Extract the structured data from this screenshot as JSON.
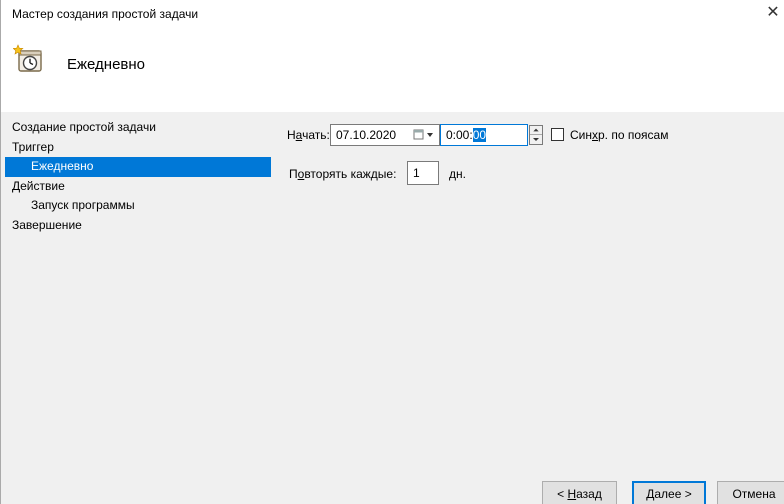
{
  "window": {
    "title": "Мастер создания простой задачи",
    "close_glyph": "✕"
  },
  "header": {
    "heading": "Ежедневно",
    "icon": "task-clock-icon"
  },
  "steps": [
    {
      "label": "Создание простой задачи",
      "level": 0,
      "active": false
    },
    {
      "label": "Триггер",
      "level": 0,
      "active": false
    },
    {
      "label": "Ежедневно",
      "level": 1,
      "active": true
    },
    {
      "label": "Действие",
      "level": 0,
      "active": false
    },
    {
      "label": "Запуск программы",
      "level": 1,
      "active": false
    },
    {
      "label": "Завершение",
      "level": 0,
      "active": false
    }
  ],
  "form": {
    "start_label_pre": "Н",
    "start_label_ul": "а",
    "start_label_post": "чать:",
    "start_date": "07.10.2020",
    "start_time_pre": "0:00:",
    "start_time_sel": "00",
    "sync_label_pre": "Син",
    "sync_label_ul": "х",
    "sync_label_post": "р. по поясам",
    "sync_checked": false,
    "repeat_label_pre": "П",
    "repeat_label_ul": "о",
    "repeat_label_post": "вторять каждые:",
    "repeat_value": "1",
    "repeat_unit": "дн."
  },
  "buttons": {
    "back_pre": "< ",
    "back_ul": "Н",
    "back_post": "азад",
    "next_ul": "Д",
    "next_post": "алее >",
    "cancel": "Отмена"
  },
  "colors": {
    "accent": "#0078d7",
    "panel": "#f0f0f0"
  }
}
